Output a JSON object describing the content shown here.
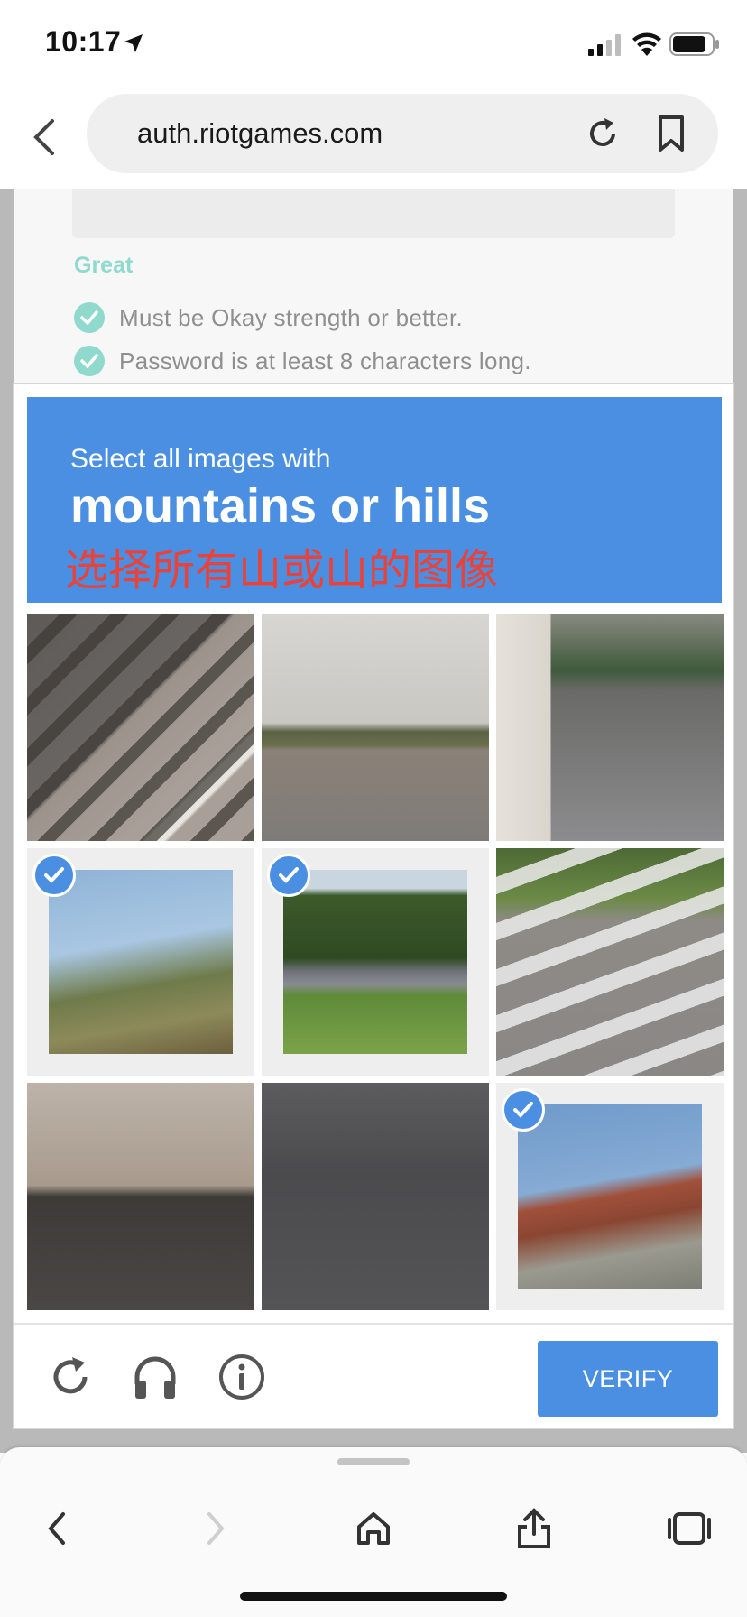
{
  "status_bar": {
    "time": "10:17",
    "icons": [
      "location-arrow-icon",
      "cellular-signal-icon",
      "wifi-icon",
      "battery-icon"
    ]
  },
  "browser": {
    "url": "auth.riotgames.com",
    "icons": [
      "back-chevron-icon",
      "reload-icon",
      "bookmark-icon"
    ]
  },
  "page": {
    "strength_label": "Great",
    "rules": [
      "Must be Okay strength or better.",
      "Password is at least 8 characters long."
    ],
    "accent_color": "#8fd9cd"
  },
  "captcha": {
    "prompt_small": "Select all images with",
    "prompt_big": "mountains or hills",
    "prompt_translation": "选择所有山或山的图像",
    "header_color": "#4a8fe2",
    "tiles": [
      {
        "subject": "pavement-vent",
        "selected": false
      },
      {
        "subject": "highway-road",
        "selected": false
      },
      {
        "subject": "street-corner-motorcycle",
        "selected": false
      },
      {
        "subject": "palm-trees-hillside",
        "selected": true
      },
      {
        "subject": "wooded-hill-guardrail",
        "selected": true
      },
      {
        "subject": "crosswalk-parked-car",
        "selected": false
      },
      {
        "subject": "storefront-car",
        "selected": false
      },
      {
        "subject": "asphalt-road",
        "selected": false
      },
      {
        "subject": "red-rocky-hill",
        "selected": true
      }
    ],
    "verify_label": "VERIFY",
    "footer_icons": [
      "refresh-icon",
      "headphones-icon",
      "info-icon"
    ]
  },
  "toolbar": {
    "icons": [
      "back-icon",
      "forward-icon",
      "home-icon",
      "share-icon",
      "tabs-icon"
    ]
  }
}
